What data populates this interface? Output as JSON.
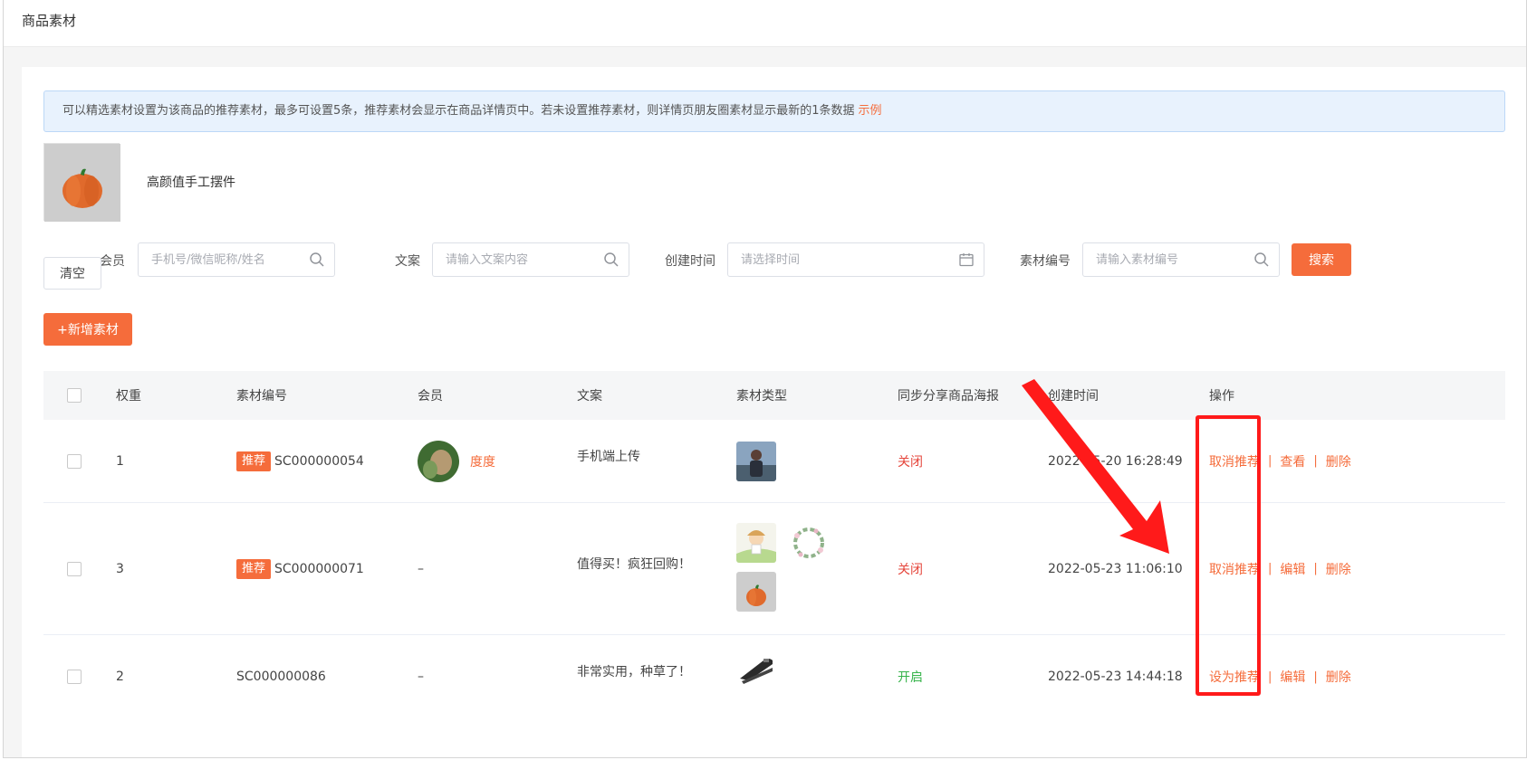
{
  "page": {
    "title": "商品素材"
  },
  "notice": {
    "text": "可以精选素材设置为该商品的推荐素材，最多可设置5条，推荐素材会显示在商品详情页中。若未设置推荐素材，则详情页朋友圈素材显示最新的1条数据",
    "link": "示例"
  },
  "product": {
    "name": "高颜值手工摆件"
  },
  "filters": {
    "member": {
      "label": "会员",
      "placeholder": "手机号/微信昵称/姓名"
    },
    "copy": {
      "label": "文案",
      "placeholder": "请输入文案内容"
    },
    "created": {
      "label": "创建时间",
      "placeholder": "请选择时间"
    },
    "code": {
      "label": "素材编号",
      "placeholder": "请输入素材编号"
    },
    "search_label": "搜索",
    "clear_label": "清空"
  },
  "add_button": "+新增素材",
  "table": {
    "headers": [
      "权重",
      "素材编号",
      "会员",
      "文案",
      "素材类型",
      "同步分享商品海报",
      "创建时间",
      "操作"
    ],
    "rows": [
      {
        "weight": "1",
        "tag": "推荐",
        "code": "SC000000054",
        "member": "度度",
        "copy": "手机端上传",
        "poster": "关闭",
        "created": "2022-05-20 16:28:49",
        "actions": [
          "取消推荐",
          "查看",
          "删除"
        ]
      },
      {
        "weight": "3",
        "tag": "推荐",
        "code": "SC000000071",
        "member": "–",
        "copy": "值得买！疯狂回购！",
        "poster": "关闭",
        "created": "2022-05-23 11:06:10",
        "actions": [
          "取消推荐",
          "编辑",
          "删除"
        ]
      },
      {
        "weight": "2",
        "tag": "",
        "code": "SC000000086",
        "member": "–",
        "copy": "非常实用，种草了！",
        "poster": "开启",
        "created": "2022-05-23 14:44:18",
        "actions": [
          "设为推荐",
          "编辑",
          "删除"
        ]
      }
    ]
  },
  "colors": {
    "accent": "#f56c3b",
    "status_off": "#e5453b",
    "status_on": "#36b34a",
    "annotation": "#ff1a1a"
  }
}
